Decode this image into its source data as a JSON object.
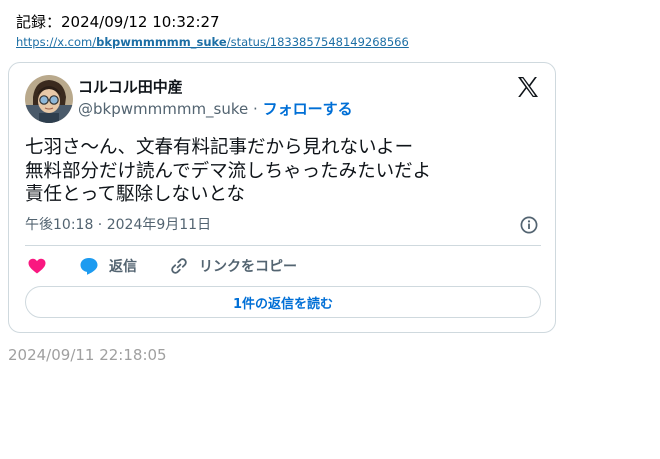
{
  "record": {
    "label": "記録：2024/09/12 10:32:27"
  },
  "link": {
    "prefix": "https://x.com/",
    "username": "bkpwmmmmm_suke",
    "suffix": "/status/1833857548149268566"
  },
  "tweet": {
    "display_name": "コルコル田中産",
    "handle": "@bkpwmmmmm_suke",
    "separator": " · ",
    "follow_label": "フォローする",
    "lines": [
      "七羽さ〜ん、文春有料記事だから見れないよー",
      "無料部分だけ読んでデマ流しちゃったみたいだよ",
      "責任とって駆除しないとな"
    ],
    "time": "午後10:18",
    "date_separator": " · ",
    "date": "2024年9月11日",
    "actions": {
      "reply_label": "返信",
      "copy_link_label": "リンクをコピー"
    },
    "read_replies_label": "1件の返信を読む"
  },
  "footer_timestamp": "2024/09/11 22:18:05",
  "colors": {
    "link": "#1d6fa5",
    "accent_blue": "#006fd6",
    "like_pink": "#f91880",
    "reply_blue": "#1d9bf0",
    "muted": "#536471",
    "border": "#cfd9de",
    "timestamp_gray": "#a0a0a0"
  },
  "icons": {
    "x_logo": "x-logo-icon",
    "info": "info-icon",
    "like": "heart-icon",
    "reply": "speech-bubble-icon",
    "copy_link": "link-icon"
  }
}
